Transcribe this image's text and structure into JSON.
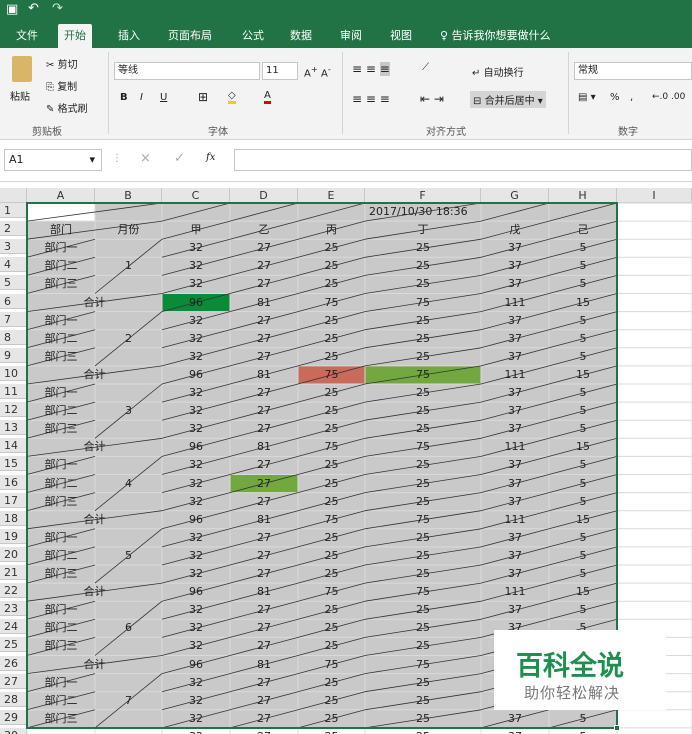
{
  "ribbon_tabs": [
    "文件",
    "开始",
    "插入",
    "页面布局",
    "公式",
    "数据",
    "审阅",
    "视图"
  ],
  "active_tab": "开始",
  "tell_me": "告诉我你想要做什么",
  "clipboard": {
    "paste": "粘贴",
    "cut": "剪切",
    "copy": "复制",
    "format_painter": "格式刷",
    "group": "剪贴板"
  },
  "font": {
    "name": "等线",
    "size": "11",
    "bold": "B",
    "italic": "I",
    "underline": "U",
    "group": "字体"
  },
  "alignment": {
    "wrap": "自动换行",
    "merge": "合并后居中",
    "group": "对齐方式"
  },
  "number": {
    "format": "常规",
    "percent": "%",
    "comma": ",",
    "group": "数字"
  },
  "formula_bar": {
    "name_box": "A1",
    "fx": "fx",
    "cancel": "×",
    "enter": "✓"
  },
  "columns": [
    "A",
    "B",
    "C",
    "D",
    "E",
    "F",
    "G",
    "H",
    "I"
  ],
  "timestamp": "2017/10/30 18:36",
  "headers": [
    "部门",
    "月份",
    "甲",
    "乙",
    "丙",
    "丁",
    "戊",
    "己"
  ],
  "dept_labels": [
    "部门一",
    "部门二",
    "部门三"
  ],
  "total_label": "合计",
  "months": [
    "1",
    "2",
    "3",
    "4",
    "5",
    "6",
    "7"
  ],
  "dept_values": [
    32,
    27,
    25,
    25,
    37,
    5
  ],
  "total_values": [
    96,
    81,
    75,
    75,
    111,
    15
  ],
  "row30_values": [
    32,
    27,
    25,
    25,
    37,
    5
  ],
  "watermark": {
    "title": "百科全说",
    "subtitle": "助你轻松解决"
  },
  "colors": {
    "green_dark": "#0b8a3a",
    "green_mid": "#72a83f",
    "red_soft": "#c86b5b",
    "excel_green": "#217346"
  }
}
